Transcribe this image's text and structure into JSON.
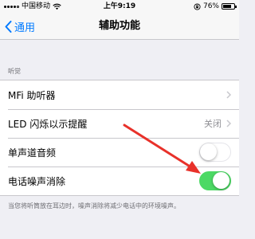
{
  "status_bar": {
    "carrier": "中国移动",
    "time": "上午9:19",
    "battery": "76%",
    "battery_level": 0.76
  },
  "nav": {
    "back_label": "通用",
    "title": "辅助功能"
  },
  "section": {
    "header": "听觉"
  },
  "rows": [
    {
      "label": "MFi 助听器"
    },
    {
      "label": "LED 闪烁以示提醒",
      "value": "关闭"
    },
    {
      "label": "单声道音频",
      "toggle": false
    },
    {
      "label": "电话噪声消除",
      "toggle": true
    }
  ],
  "footer": "当您将听筒放在耳边时，噪声消除将减少电话中的环境噪声。",
  "colors": {
    "accent": "#007aff",
    "toggle_on": "#4cd964",
    "annotation_arrow": "#e8312a"
  },
  "icons": [
    "wifi-icon",
    "lock-rotation-icon",
    "battery-icon",
    "chevron-left-icon",
    "chevron-right-icon"
  ]
}
